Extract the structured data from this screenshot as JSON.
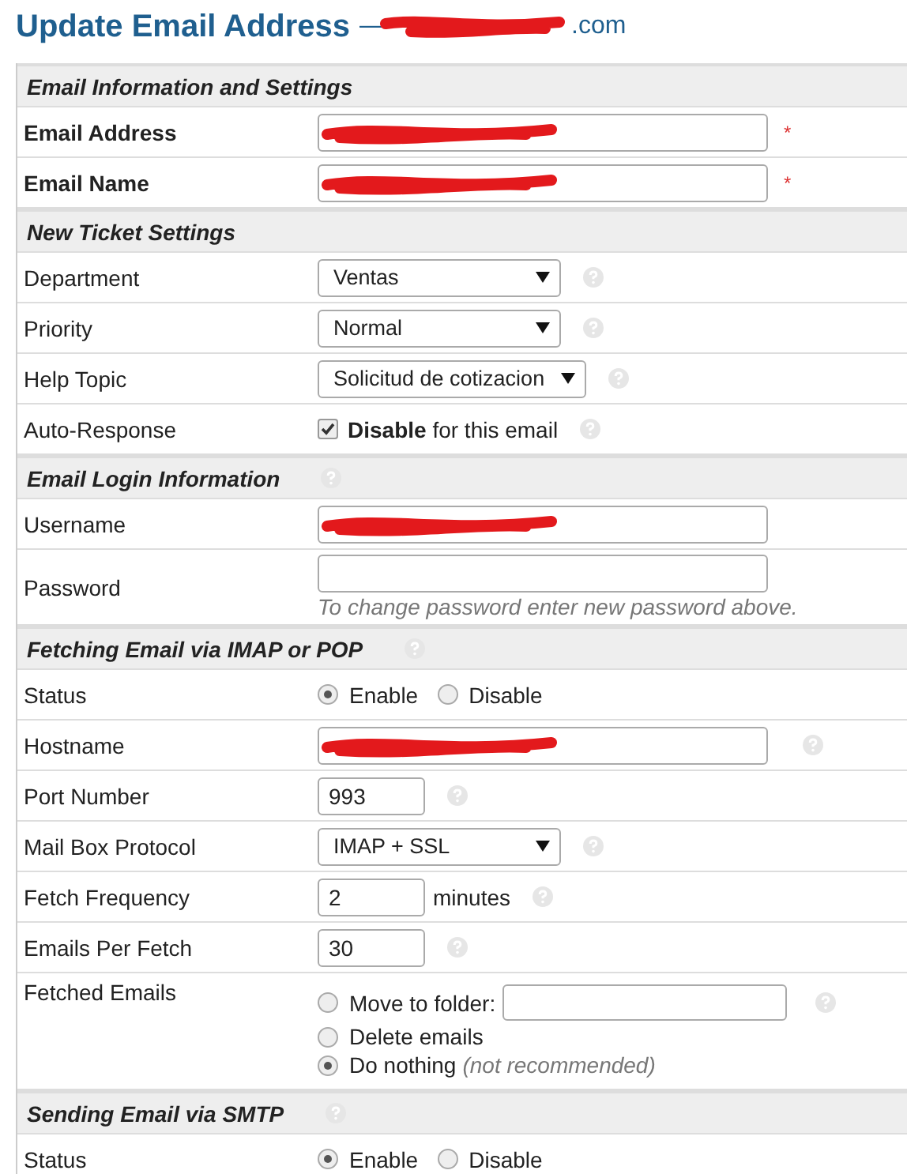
{
  "title": "Update Email Address",
  "subtitle": {
    "dash": "—",
    "tail": ".com",
    "redacted": true
  },
  "sections": [
    {
      "title": "Email Information and Settings",
      "rows": [
        {
          "kind": "text",
          "label": "Email Address",
          "bold": true,
          "redacted": true,
          "required": "*"
        },
        {
          "kind": "text",
          "label": "Email Name",
          "bold": true,
          "redacted": true,
          "required": "*"
        }
      ]
    },
    {
      "title": "New Ticket Settings",
      "rows": [
        {
          "kind": "select",
          "label": "Department",
          "value": "Ventas",
          "help": true
        },
        {
          "kind": "select",
          "label": "Priority",
          "value": "Normal",
          "help": true
        },
        {
          "kind": "select",
          "label": "Help Topic",
          "value": "Solicitud de cotizacion",
          "help": true
        },
        {
          "kind": "checkbox",
          "label": "Auto-Response",
          "checked": true,
          "strong": "Disable",
          "text": "for this email",
          "help": true
        }
      ]
    },
    {
      "title": "Email Login Information",
      "help": true,
      "rows": [
        {
          "kind": "text",
          "label": "Username",
          "redacted": true
        },
        {
          "kind": "text",
          "label": "Password",
          "hint": "To change password enter new password above."
        }
      ]
    },
    {
      "title": "Fetching Email via IMAP or POP",
      "help": true,
      "rows": [
        {
          "kind": "radios",
          "label": "Status",
          "options": [
            {
              "label": "Enable",
              "selected": true
            },
            {
              "label": "Disable",
              "selected": false
            }
          ]
        },
        {
          "kind": "text",
          "label": "Hostname",
          "redacted": true,
          "help": true
        },
        {
          "kind": "number",
          "label": "Port Number",
          "value": "993",
          "help": true
        },
        {
          "kind": "select",
          "label": "Mail Box Protocol",
          "value": "IMAP + SSL",
          "help": true
        },
        {
          "kind": "number",
          "label": "Fetch Frequency",
          "value": "2",
          "unit": "minutes",
          "help": true
        },
        {
          "kind": "number",
          "label": "Emails Per Fetch",
          "value": "30",
          "help": true
        },
        {
          "kind": "radiolist",
          "label": "Fetched Emails",
          "help": true,
          "options": [
            {
              "label": "Move to folder:",
              "selected": false,
              "field": true
            },
            {
              "label": "Delete emails",
              "selected": false
            },
            {
              "label": "Do nothing",
              "note": "(not recommended)",
              "selected": true
            }
          ]
        }
      ]
    },
    {
      "title": "Sending Email via SMTP",
      "help": true,
      "rows": [
        {
          "kind": "radios",
          "label": "Status",
          "options": [
            {
              "label": "Enable",
              "selected": true
            },
            {
              "label": "Disable",
              "selected": false
            }
          ]
        }
      ]
    }
  ]
}
